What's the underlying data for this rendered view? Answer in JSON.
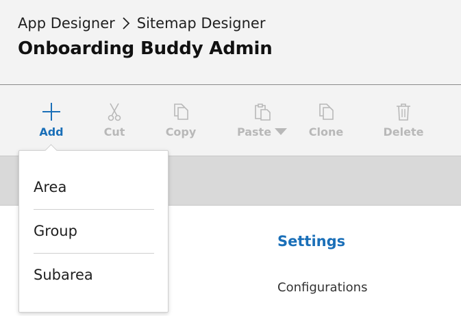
{
  "header": {
    "breadcrumb": {
      "items": [
        {
          "label": "App Designer"
        },
        {
          "label": "Sitemap Designer"
        }
      ]
    },
    "title": "Onboarding Buddy Admin"
  },
  "toolbar": {
    "buttons": [
      {
        "label": "Add",
        "icon": "plus-icon",
        "enabled": true
      },
      {
        "label": "Cut",
        "icon": "scissors-icon",
        "enabled": false
      },
      {
        "label": "Copy",
        "icon": "copy-icon",
        "enabled": false
      },
      {
        "label": "Paste",
        "icon": "paste-icon",
        "enabled": false,
        "has_dropdown": true
      },
      {
        "label": "Clone",
        "icon": "clone-icon",
        "enabled": false
      },
      {
        "label": "Delete",
        "icon": "trash-icon",
        "enabled": false
      }
    ]
  },
  "add_menu": {
    "items": [
      {
        "label": "Area"
      },
      {
        "label": "Group"
      },
      {
        "label": "Subarea"
      }
    ]
  },
  "main": {
    "settings_heading": "Settings",
    "configurations_label": "Configurations"
  },
  "colors": {
    "accent": "#1a6fb8",
    "disabled": "#b8b8b8",
    "header_bg": "#f3f3f3",
    "canvas_band": "#d9d9d9"
  }
}
